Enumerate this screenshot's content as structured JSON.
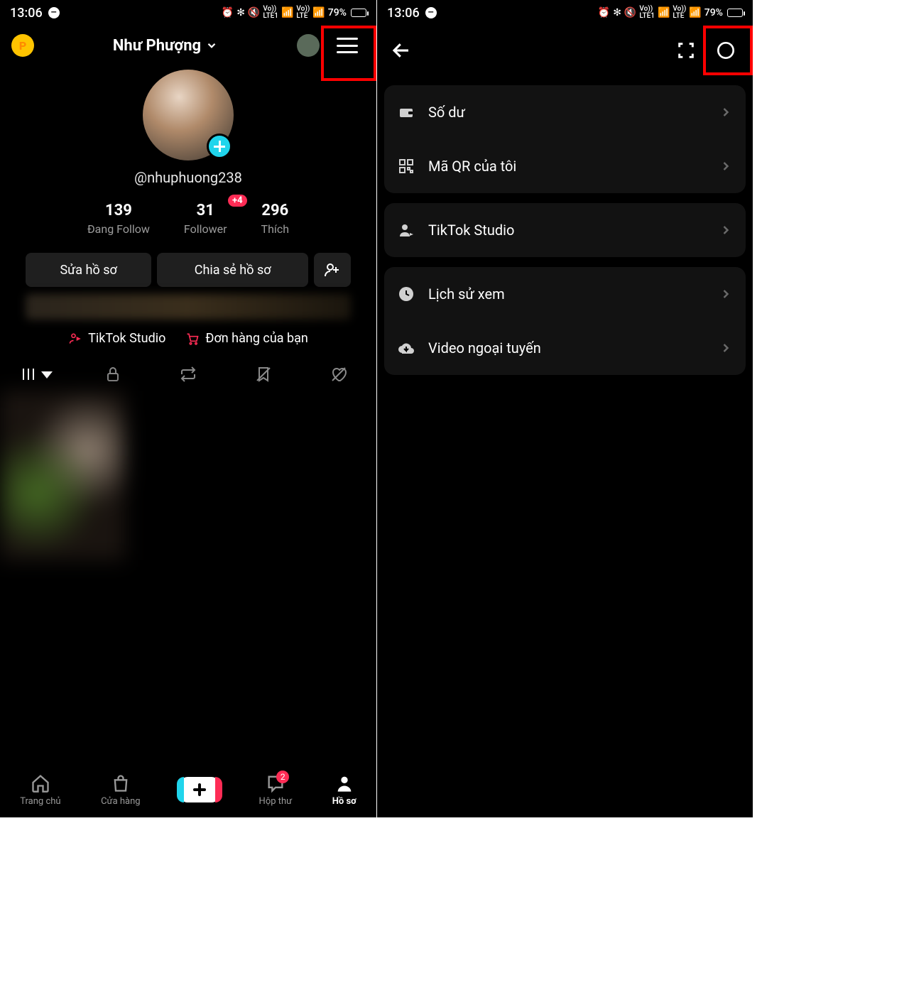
{
  "status": {
    "time": "13:06",
    "battery_pct": "79%"
  },
  "left": {
    "coin_letter": "P",
    "display_name": "Như Phượng",
    "handle": "@nhuphuong238",
    "stats": {
      "following": {
        "count": "139",
        "label": "Đang Follow"
      },
      "followers": {
        "count": "31",
        "label": "Follower",
        "delta": "+4"
      },
      "likes": {
        "count": "296",
        "label": "Thích"
      }
    },
    "buttons": {
      "edit": "Sửa hồ sơ",
      "share": "Chia sẻ hồ sơ"
    },
    "quicklinks": {
      "studio": "TikTok Studio",
      "orders": "Đơn hàng của bạn"
    },
    "nav": {
      "home": "Trang chủ",
      "shop": "Cửa hàng",
      "inbox": "Hộp thư",
      "inbox_badge": "2",
      "profile": "Hồ sơ"
    }
  },
  "right": {
    "menu": {
      "balance": "Số dư",
      "qr": "Mã QR của tôi",
      "studio": "TikTok Studio",
      "history": "Lịch sử xem",
      "offline": "Video ngoại tuyến"
    }
  }
}
